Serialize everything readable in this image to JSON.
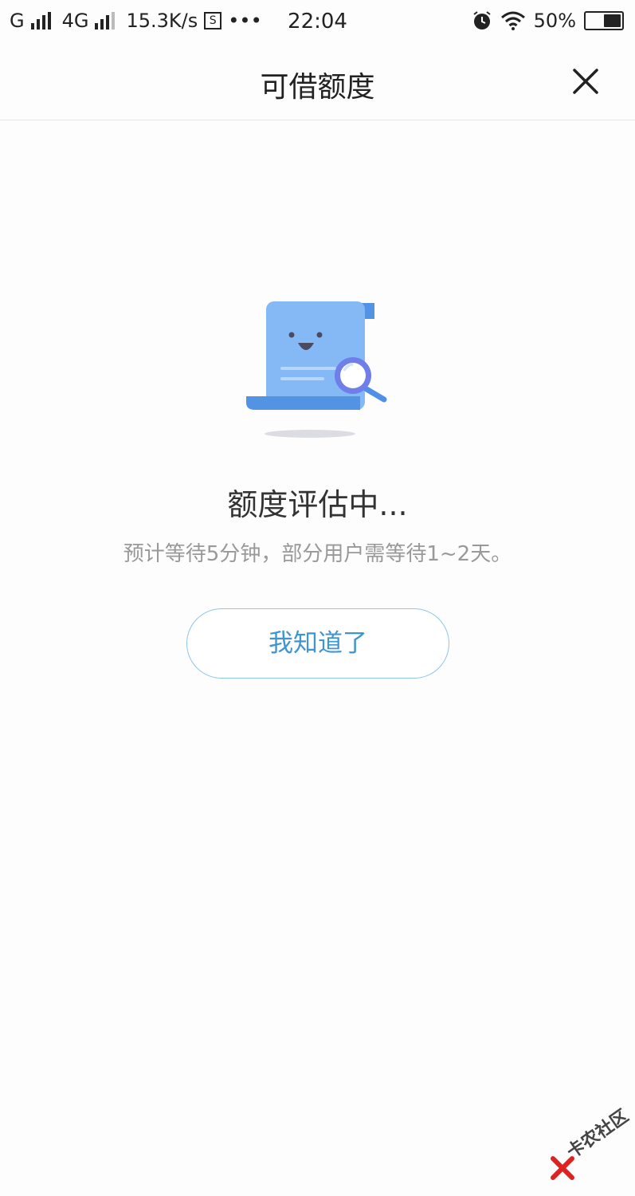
{
  "status_bar": {
    "carrier1": "G",
    "carrier2": "4G",
    "speed": "15.3K/s",
    "s_icon": "S",
    "more": "•••",
    "time": "22:04",
    "battery_percent": "50%",
    "battery_level": 0.5,
    "icons": [
      "signal-icon",
      "alarm-icon",
      "wifi-icon",
      "battery-icon"
    ]
  },
  "header": {
    "title": "可借额度",
    "close_icon": "close-icon"
  },
  "main": {
    "illustration_icon": "document-search-icon",
    "status_title": "额度评估中...",
    "status_subtitle": "预计等待5分钟，部分用户需等待1~2天。",
    "button_label": "我知道了"
  },
  "watermark": {
    "text": "卡农社区"
  },
  "colors": {
    "accent": "#3d95d2",
    "button_border": "#8cc6ea",
    "doc_blue": "#84b9f6",
    "doc_dark": "#5393e3"
  }
}
